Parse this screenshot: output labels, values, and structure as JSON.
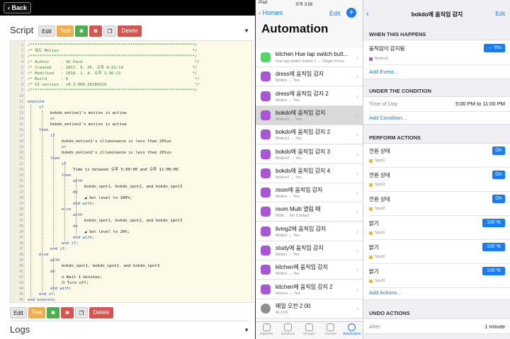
{
  "left": {
    "back_label": "Back",
    "script_heading": "Script",
    "logs_heading": "Logs",
    "toolbar": {
      "edit": "Edit",
      "test": "Test",
      "delete": "Delete"
    },
    "line_numbers": [
      "1",
      "2",
      "3",
      "4",
      "5",
      "6",
      "7",
      "8",
      "9",
      "10",
      "11",
      "12",
      "13",
      "14",
      "15",
      "16",
      "17",
      "18",
      "19",
      "20",
      "21",
      "22",
      "23",
      "24",
      "25",
      "26",
      "27",
      "28",
      "29",
      "30",
      "31",
      "32",
      "33",
      "34",
      "35",
      "36",
      "37",
      "38",
      "39",
      "40",
      "41",
      "42",
      "43",
      "44",
      "45",
      "46",
      "47",
      "48",
      "49"
    ],
    "code": {
      "c1": "/*********************************************************************/",
      "c2": "/* 복도 Motion                                                        */",
      "c3": "/*********************************************************************/",
      "c4": "/* Author     : SK Park                                               */",
      "c5": "/* Created    : 2017. 9. 26. 오후 9:13:19                             */",
      "c6": "/* Modified   : 2018. 1. 8. 오후 1:36:21                              */",
      "c7": "/* Build      : 6                                                     */",
      "c8": "/* UI version : v0.3.000.20180224                                     */",
      "c9": "/*********************************************************************/",
      "execute": "execute",
      "if1": "if",
      "m1": "bokdo_motion1's motion is active",
      "or1": "or",
      "m2": "bokdo_motion2's motion is active",
      "then1": "then",
      "if2": "if",
      "l1": "bokdo_motion1's illuminance is less than 20lux",
      "or2": "or",
      "l2": "bokdo_motion2's illuminance is less than 20lux",
      "then2": "then",
      "if3": "if",
      "time": "Time is between 오후 5:00:00 and 오후 11:00:00",
      "then3": "then",
      "with1": "with",
      "spots1": "bokdo_spot1, bokdo_spot2, and bokdo_spot3",
      "do1": "do",
      "set100": "Set level to 100%;",
      "endwith1": "end with;",
      "else1": "else",
      "with2": "with",
      "spots2": "bokdo_spot1, bokdo_spot2, and bokdo_spot3",
      "do2": "do",
      "set20": "Set level to 20%;",
      "endwith2": "end with;",
      "endif1": "end if;",
      "endif2": "end if;",
      "else2": "else",
      "with3": "with",
      "spots3": "bokdo_spot1, bokdo_spot2, and bokdo_spot3",
      "do3": "do",
      "wait": "Wait 1 minutes;",
      "turnoff": "Turn off;",
      "endwith3": "end with;",
      "endif3": "end if;",
      "endexec": "end execute;"
    }
  },
  "middle": {
    "status_left": "iPad",
    "status_time": "오후 3:56",
    "back_label": "Homes",
    "edit_label": "Edit",
    "title": "Automation",
    "items": [
      {
        "title": "kitchen Hue tap switch butt...",
        "sub": "Hue tap switch button 1 → Single Press"
      },
      {
        "title": "dress에 움직임 감지",
        "sub": "Motion → Yes"
      },
      {
        "title": "dress에 움직임 감지 2",
        "sub": "Motion → Yes"
      },
      {
        "title": "bokdo에 움직임 감지",
        "sub": "Motion1 → Yes"
      },
      {
        "title": "bokdo에 움직임 감지 2",
        "sub": "Motion1 → Yes"
      },
      {
        "title": "bokdo에 움직임 감지 3",
        "sub": "Motion2 → Yes"
      },
      {
        "title": "bokdo에 움직임 감지 4",
        "sub": "Motion2 → Yes"
      },
      {
        "title": "mom에 움직임 감지",
        "sub": "Motion → Yes"
      },
      {
        "title": "mom Multi 열림 때",
        "sub": "Multi → No Contact"
      },
      {
        "title": "living2에 움직임 감지",
        "sub": "Motion → Yes"
      },
      {
        "title": "study에 움직임 감지",
        "sub": "Motion → Yes"
      },
      {
        "title": "kitchen에 움직임 감지",
        "sub": "Motion → Yes"
      },
      {
        "title": "kitchen에 움직임 감지 2",
        "sub": "kitchen → Yes"
      },
      {
        "title": "매일 오전 2 00",
        "sub": "At 2:00"
      }
    ],
    "tabs": [
      "sejunine",
      "Services",
      "Groups",
      "Scenes",
      "Automation"
    ]
  },
  "right": {
    "title": "bokdo에 움직임 감지",
    "edit_label": "Edit",
    "when_heading": "WHEN THIS HAPPENS",
    "trigger_label": "움직임이 감지됨",
    "trigger_value": "→ Yes",
    "trigger_sub": "Motion1",
    "add_event": "Add Event...",
    "condition_heading": "UNDER THE CONDITION",
    "cond_label": "Time of Day",
    "cond_value": "5:00 PM to 11:00 PM",
    "add_condition": "Add Condition...",
    "actions_heading": "PERFORM ACTIONS",
    "actions": [
      {
        "label": "전원 상태",
        "value": "On",
        "sub": "Spot1"
      },
      {
        "label": "전원 상태",
        "value": "On",
        "sub": "Spot3"
      },
      {
        "label": "전원 상태",
        "value": "On",
        "sub": "Spot2"
      },
      {
        "label": "밝기",
        "value": "100 %",
        "sub": "Spot1"
      },
      {
        "label": "밝기",
        "value": "100 %",
        "sub": "Spot2"
      },
      {
        "label": "밝기",
        "value": "100 %",
        "sub": "Spot3"
      }
    ],
    "add_actions": "Add Actions...",
    "undo_heading": "UNDO ACTIONS",
    "undo_label": "After",
    "undo_value": "1 minute"
  }
}
